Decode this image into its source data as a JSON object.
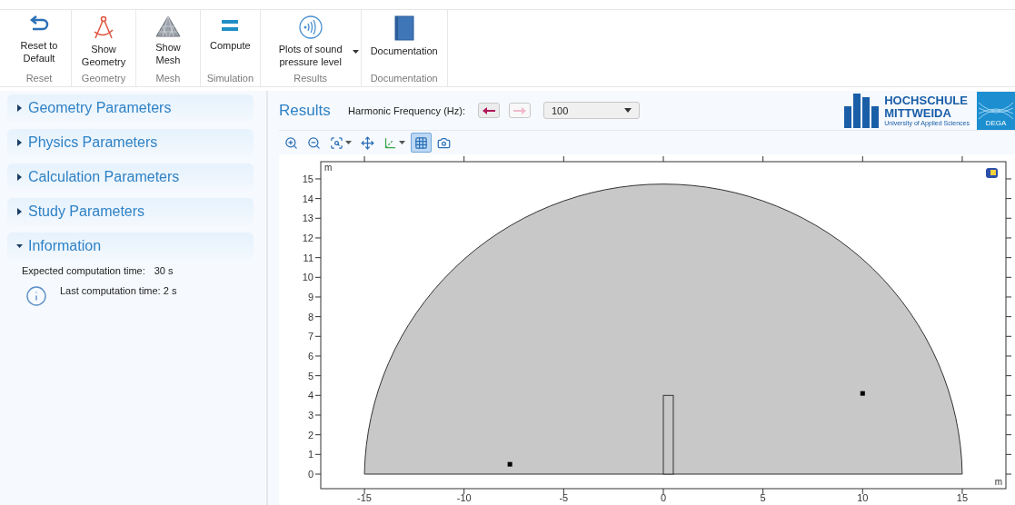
{
  "ribbon": {
    "groups": [
      {
        "label": "Reset",
        "buttons": [
          {
            "label": "Reset to Default",
            "kind": "reset",
            "has_menu": false
          }
        ]
      },
      {
        "label": "Geometry",
        "buttons": [
          {
            "label": "Show Geometry",
            "kind": "geometry",
            "has_menu": false
          }
        ]
      },
      {
        "label": "Mesh",
        "buttons": [
          {
            "label": "Show Mesh",
            "kind": "mesh",
            "has_menu": false
          }
        ]
      },
      {
        "label": "Simulation",
        "buttons": [
          {
            "label": "Compute",
            "kind": "compute",
            "has_menu": false
          }
        ]
      },
      {
        "label": "Results",
        "buttons": [
          {
            "label": "Plots of sound pressure level",
            "kind": "sound",
            "has_menu": true
          }
        ]
      },
      {
        "label": "Documentation",
        "buttons": [
          {
            "label": "Documentation",
            "kind": "book",
            "has_menu": false
          }
        ]
      }
    ]
  },
  "sidebar": {
    "sections": [
      {
        "title": "Geometry Parameters",
        "expanded": false
      },
      {
        "title": "Physics Parameters",
        "expanded": false
      },
      {
        "title": "Calculation Parameters",
        "expanded": false
      },
      {
        "title": "Study Parameters",
        "expanded": false
      },
      {
        "title": "Information",
        "expanded": true,
        "fields": [
          {
            "label": "Expected computation time:",
            "value": "30 s"
          }
        ],
        "note": "Last computation time: 2 s"
      }
    ]
  },
  "results": {
    "title": "Results",
    "frequency": {
      "label": "Harmonic Frequency (Hz):",
      "previous_disabled": false,
      "next_disabled": true,
      "value": "100"
    },
    "logos": [
      {
        "kind": "hsmw",
        "lines": [
          "HOCHSCHULE",
          "MITTWEIDA",
          "University of Applied Sciences"
        ]
      },
      {
        "kind": "dega",
        "lines": [
          "DEGA"
        ]
      }
    ],
    "toolbar": [
      {
        "kind": "zoom-in",
        "has_menu": false,
        "selected": false
      },
      {
        "kind": "zoom-out",
        "has_menu": false,
        "selected": false
      },
      {
        "kind": "zoom-box",
        "has_menu": true,
        "selected": false
      },
      {
        "kind": "zoom-extents",
        "has_menu": false,
        "selected": false
      },
      {
        "kind": "axes",
        "has_menu": true,
        "selected": false
      },
      {
        "kind": "grid",
        "has_menu": false,
        "selected": true
      },
      {
        "kind": "camera",
        "has_menu": false,
        "selected": false
      }
    ],
    "plot": {
      "x_unit": "m",
      "y_unit": "m",
      "x_tick_labels": [
        "-15",
        "-10",
        "-5",
        "0",
        "5",
        "10",
        "15"
      ],
      "y_tick_labels": [
        "15",
        "14",
        "13",
        "12",
        "11",
        "10",
        "9",
        "8",
        "7",
        "6",
        "5",
        "4",
        "3",
        "2",
        "1",
        "0"
      ]
    }
  }
}
